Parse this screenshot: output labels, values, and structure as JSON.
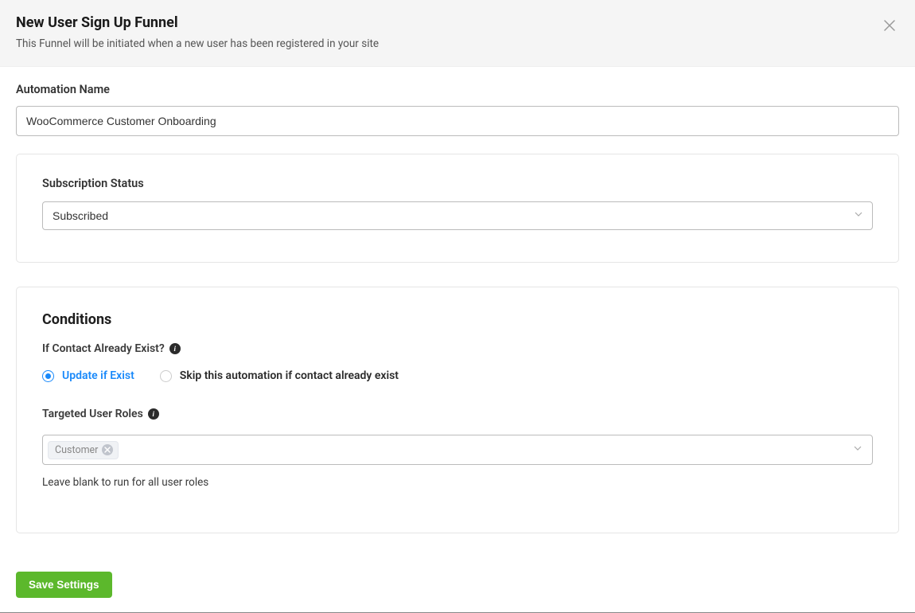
{
  "header": {
    "title": "New User Sign Up Funnel",
    "subtitle": "This Funnel will be initiated when a new user has been registered in your site"
  },
  "automation_name": {
    "label": "Automation Name",
    "value": "WooCommerce Customer Onboarding"
  },
  "subscription_status": {
    "label": "Subscription Status",
    "selected": "Subscribed"
  },
  "conditions": {
    "title": "Conditions",
    "contact_exist": {
      "label": "If Contact Already Exist?",
      "options": {
        "update": "Update if Exist",
        "skip": "Skip this automation if contact already exist"
      },
      "selected": "update"
    },
    "roles": {
      "label": "Targeted User Roles",
      "tags": [
        "Customer"
      ],
      "helper": "Leave blank to run for all user roles"
    }
  },
  "footer": {
    "save_label": "Save Settings"
  }
}
